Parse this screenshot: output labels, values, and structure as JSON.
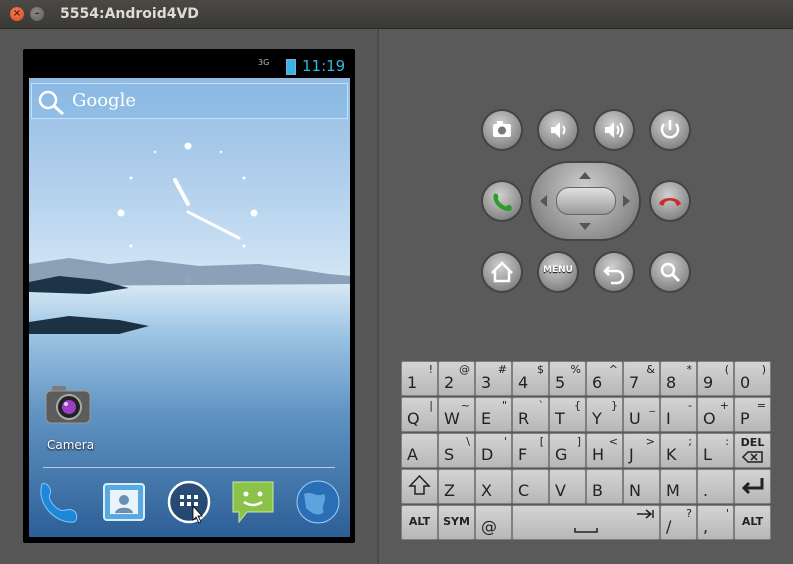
{
  "window": {
    "title": "5554:Android4VD",
    "close_glyph": "×",
    "min_glyph": "–"
  },
  "status": {
    "network": "3G",
    "time": "11:19"
  },
  "search": {
    "brand": "Google"
  },
  "home": {
    "camera_label": "Camera"
  },
  "dock": [
    "phone",
    "contacts",
    "apps",
    "messaging",
    "browser"
  ],
  "controls": {
    "menu_label": "MENU"
  },
  "keyboard": {
    "row1": [
      [
        "1",
        "!"
      ],
      [
        "2",
        "@"
      ],
      [
        "3",
        "#"
      ],
      [
        "4",
        "$"
      ],
      [
        "5",
        "%"
      ],
      [
        "6",
        "^"
      ],
      [
        "7",
        "&"
      ],
      [
        "8",
        "*"
      ],
      [
        "9",
        "("
      ],
      [
        "0",
        ")"
      ]
    ],
    "row2": [
      [
        "Q",
        "|"
      ],
      [
        "W",
        "~"
      ],
      [
        "E",
        "\""
      ],
      [
        "R",
        "`"
      ],
      [
        "T",
        "{"
      ],
      [
        "Y",
        "}"
      ],
      [
        "U",
        "_"
      ],
      [
        "I",
        "-"
      ],
      [
        "O",
        "+"
      ],
      [
        "P",
        "="
      ]
    ],
    "row3": [
      [
        "A",
        ""
      ],
      [
        "S",
        "\\"
      ],
      [
        "D",
        "'"
      ],
      [
        "F",
        "["
      ],
      [
        "G",
        "]"
      ],
      [
        "H",
        "<"
      ],
      [
        "J",
        ">"
      ],
      [
        "K",
        ";"
      ],
      [
        "L",
        ":"
      ]
    ],
    "row4": [
      [
        "Z",
        ""
      ],
      [
        "X",
        ""
      ],
      [
        "C",
        ""
      ],
      [
        "V",
        ""
      ],
      [
        "B",
        ""
      ],
      [
        "N",
        ""
      ],
      [
        "M",
        ""
      ],
      [
        ".",
        ""
      ]
    ],
    "del_label": "DEL",
    "alt_label": "ALT",
    "sym_label": "SYM",
    "at_label": "@",
    "slash_main": "/",
    "slash_sub": "?",
    "comma_main": ",",
    "comma_sub": "'"
  },
  "colors": {
    "accent": "#33b5e5",
    "call": "#2a9d2a",
    "end_call": "#cc2b2b"
  }
}
